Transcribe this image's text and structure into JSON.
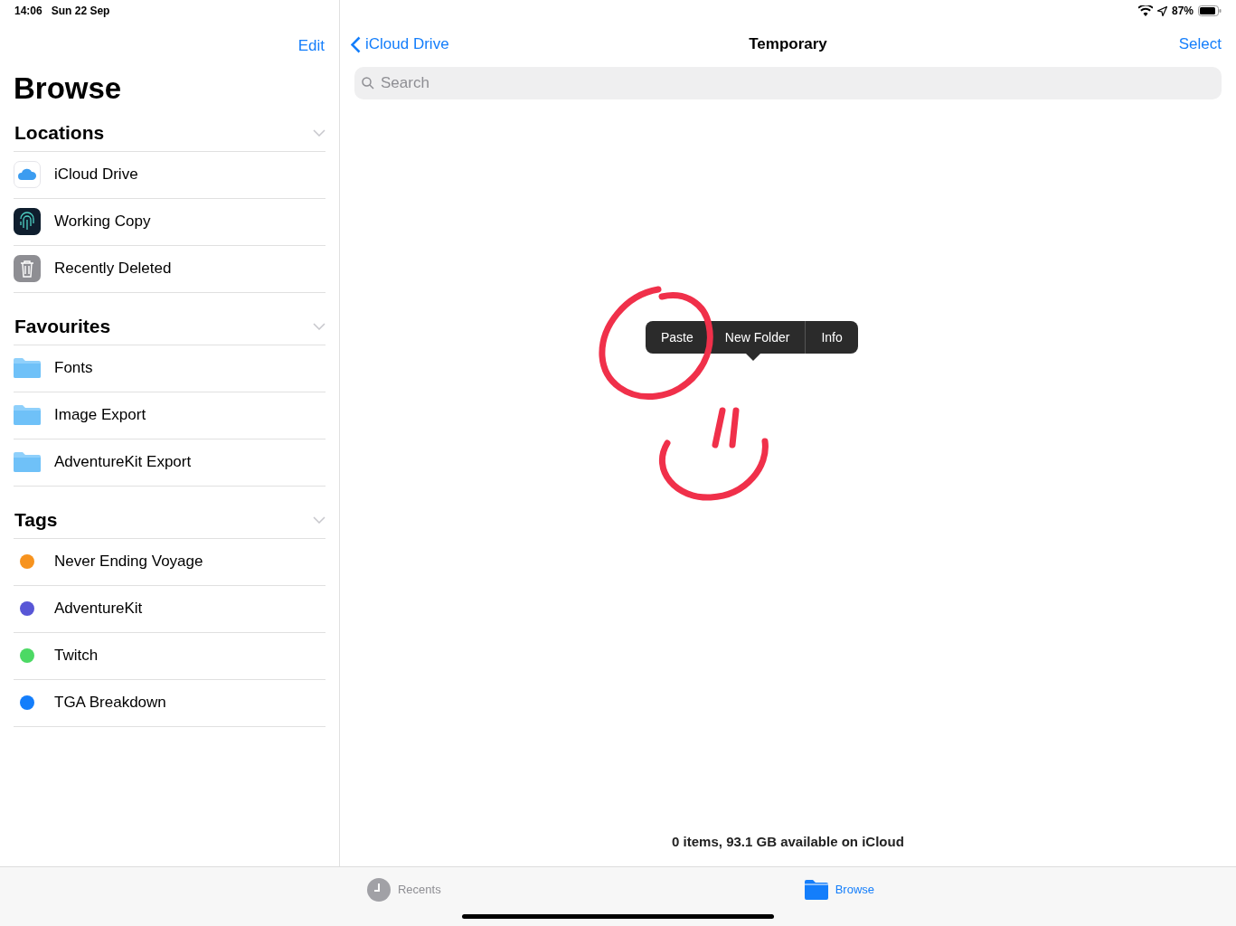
{
  "status_bar": {
    "time": "14:06",
    "date": "Sun 22 Sep",
    "battery": "87%"
  },
  "sidebar": {
    "edit": "Edit",
    "title": "Browse",
    "sections": [
      {
        "title": "Locations",
        "expanded": true,
        "items": [
          {
            "label": "iCloud Drive",
            "kind": "cloud"
          },
          {
            "label": "Working Copy",
            "kind": "app"
          },
          {
            "label": "Recently Deleted",
            "kind": "trash"
          }
        ]
      },
      {
        "title": "Favourites",
        "expanded": true,
        "items": [
          {
            "label": "Fonts",
            "kind": "folder"
          },
          {
            "label": "Image Export",
            "kind": "folder"
          },
          {
            "label": "AdventureKit Export",
            "kind": "folder"
          }
        ]
      },
      {
        "title": "Tags",
        "expanded": true,
        "items": [
          {
            "label": "Never Ending Voyage",
            "kind": "tag",
            "color": "#f7931e"
          },
          {
            "label": "AdventureKit",
            "kind": "tag",
            "color": "#5856d6"
          },
          {
            "label": "Twitch",
            "kind": "tag",
            "color": "#4cd964"
          },
          {
            "label": "TGA Breakdown",
            "kind": "tag",
            "color": "#147efb"
          }
        ]
      }
    ]
  },
  "nav": {
    "back": "iCloud Drive",
    "title": "Temporary",
    "action": "Select"
  },
  "search": {
    "placeholder": "Search"
  },
  "context_menu": [
    "Paste",
    "New Folder",
    "Info"
  ],
  "footer": "0 items, 93.1 GB available on iCloud",
  "tabs": [
    {
      "label": "Recents",
      "kind": "recents",
      "selected": false
    },
    {
      "label": "Browse",
      "kind": "browse",
      "selected": true
    }
  ]
}
